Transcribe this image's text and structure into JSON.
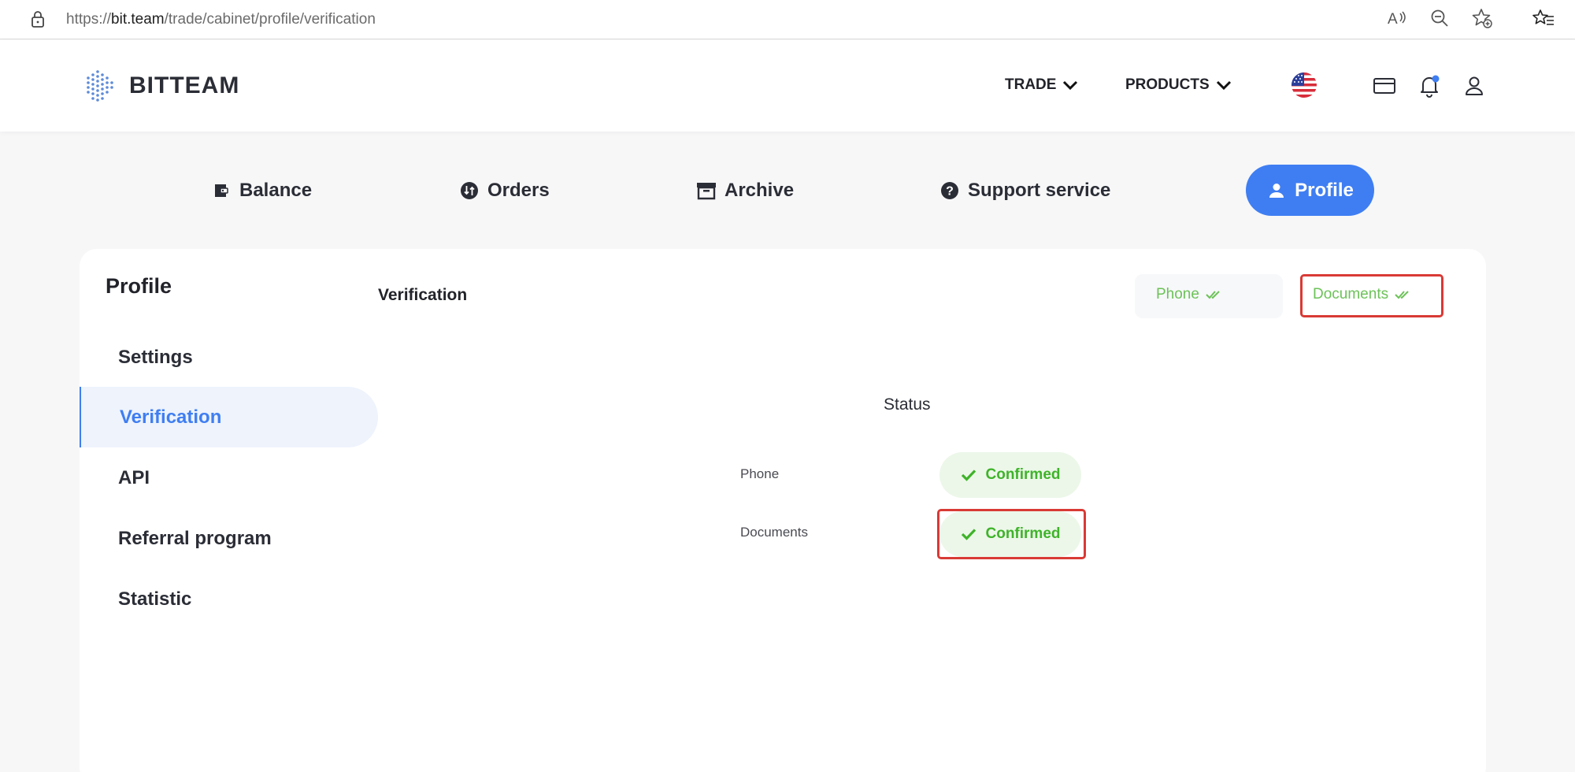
{
  "browser": {
    "url_prefix": "https://",
    "url_host": "bit.team",
    "url_path": "/trade/cabinet/profile/verification",
    "icons": [
      "lock-icon",
      "read-aloud-icon",
      "zoom-out-icon",
      "add-favorite-icon",
      "favorites-icon"
    ]
  },
  "header": {
    "logo_text": "BITTEAM",
    "nav": [
      {
        "label": "TRADE"
      },
      {
        "label": "PRODUCTS"
      }
    ],
    "icons": [
      "us-flag-icon",
      "wallet-card-icon",
      "bell-icon",
      "user-icon"
    ],
    "notification_dot_color": "#3f7ef2"
  },
  "tabs": [
    {
      "label": "Balance",
      "icon": "wallet-icon"
    },
    {
      "label": "Orders",
      "icon": "exchange-circle-icon"
    },
    {
      "label": "Archive",
      "icon": "archive-box-icon"
    },
    {
      "label": "Support service",
      "icon": "question-circle-icon"
    },
    {
      "label": "Profile",
      "icon": "user-icon",
      "active": true
    }
  ],
  "sidebar": {
    "title": "Profile",
    "items": [
      {
        "label": "Settings"
      },
      {
        "label": "Verification",
        "active": true
      },
      {
        "label": "API"
      },
      {
        "label": "Referral program"
      },
      {
        "label": "Statistic"
      }
    ]
  },
  "main": {
    "title": "Verification",
    "segments": [
      {
        "label": "Phone"
      },
      {
        "label": "Documents",
        "highlighted": true
      }
    ],
    "status_heading": "Status",
    "rows": [
      {
        "label": "Phone",
        "status": "Confirmed"
      },
      {
        "label": "Documents",
        "status": "Confirmed",
        "highlighted": true
      }
    ]
  },
  "colors": {
    "accent": "#3f7ef2",
    "success": "#3fb32a",
    "highlight": "#d93a35"
  }
}
